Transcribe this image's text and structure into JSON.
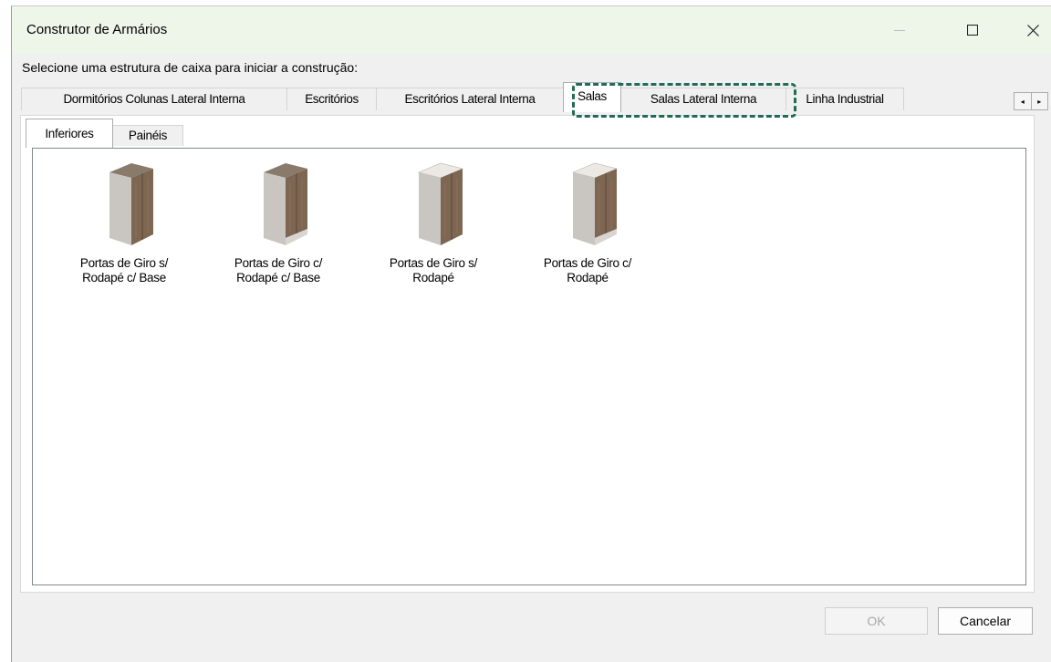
{
  "window": {
    "title": "Construtor de Armários",
    "controls": {
      "minimize": "—",
      "maximize": "☐",
      "close": "✕"
    }
  },
  "prompt": "Selecione uma estrutura de caixa para iniciar a construção:",
  "tabs": [
    {
      "label": "Dormitórios Colunas Lateral Interna",
      "active": false
    },
    {
      "label": "Escritórios",
      "active": false
    },
    {
      "label": "Escritórios Lateral Interna",
      "active": false
    },
    {
      "label": "Salas",
      "active": true
    },
    {
      "label": "Salas Lateral Interna",
      "active": false
    },
    {
      "label": "Linha Industrial",
      "active": false
    }
  ],
  "tab_scroll": {
    "left": "◂",
    "right": "▸"
  },
  "subtabs": [
    {
      "label": "Inferiores",
      "active": true
    },
    {
      "label": "Painéis",
      "active": false
    }
  ],
  "items": [
    {
      "line1": "Portas de Giro s/",
      "line2": "Rodapé c/ Base",
      "icon": "cabinet-no-plinth-with-base-icon"
    },
    {
      "line1": "Portas de Giro c/",
      "line2": "Rodapé c/ Base",
      "icon": "cabinet-plinth-with-base-icon"
    },
    {
      "line1": "Portas de Giro s/",
      "line2": "Rodapé",
      "icon": "cabinet-no-plinth-icon"
    },
    {
      "line1": "Portas de Giro c/",
      "line2": "Rodapé",
      "icon": "cabinet-plinth-icon"
    }
  ],
  "buttons": {
    "ok": "OK",
    "cancel": "Cancelar"
  },
  "colors": {
    "highlight": "#1f6b55",
    "titlebar": "#eef6ea",
    "wood": "#7d6652"
  }
}
